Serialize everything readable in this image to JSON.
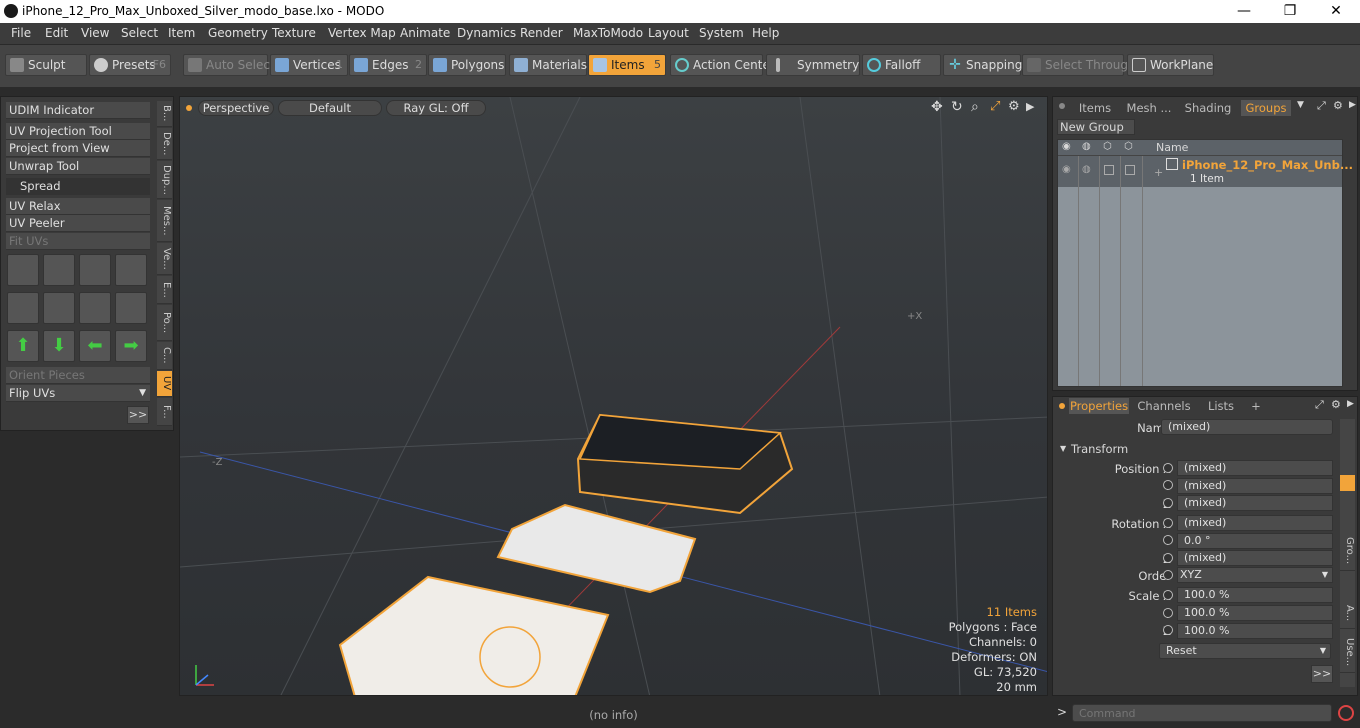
{
  "window": {
    "title": "iPhone_12_Pro_Max_Unboxed_Silver_modo_base.lxo - MODO",
    "minimize": "—",
    "maximize": "❐",
    "close": "✕"
  },
  "menu": [
    "File",
    "Edit",
    "View",
    "Select",
    "Item",
    "Geometry",
    "Texture",
    "Vertex Map",
    "Animate",
    "Dynamics",
    "Render",
    "MaxToModo",
    "Layout",
    "System",
    "Help"
  ],
  "toolbar": {
    "sculpt": "Sculpt",
    "presets": "Presets",
    "presets_key": "F6",
    "auto_select": "Auto Select",
    "vertices": "Vertices",
    "vertices_n": "1",
    "edges": "Edges",
    "edges_n": "2",
    "polygons": "Polygons",
    "materials": "Materials",
    "items": "Items",
    "items_n": "5",
    "action_center": "Action Center",
    "symmetry": "Symmetry",
    "falloff": "Falloff",
    "snapping": "Snapping",
    "select_through": "Select Through",
    "workplane": "WorkPlane"
  },
  "left": {
    "udim": "UDIM Indicator",
    "uv_proj": "UV Projection Tool",
    "proj_view": "Project from View",
    "unwrap": "Unwrap Tool",
    "spread": "Spread",
    "uv_relax": "UV Relax",
    "uv_peeler": "UV Peeler",
    "fit_uvs": "Fit UVs",
    "orient": "Orient Pieces",
    "flip": "Flip UVs",
    "more": ">>",
    "tabs": [
      "B...",
      "De...",
      "Dup...",
      "Mes...",
      "Ve...",
      "E...",
      "Po...",
      "C...",
      "UV",
      "F..."
    ]
  },
  "viewport": {
    "perspective": "Perspective",
    "default": "Default",
    "raygl": "Ray GL: Off",
    "axis_z": "-Z",
    "axis_x": "+X",
    "info": {
      "items": "11 Items",
      "polygons": "Polygons : Face",
      "channels": "Channels: 0",
      "deformers": "Deformers: ON",
      "gl": "GL: 73,520",
      "scale": "20 mm"
    }
  },
  "status": {
    "text": "(no info)"
  },
  "rtop": {
    "tabs": [
      "Items",
      "Mesh ...",
      "Shading",
      "Groups"
    ],
    "new_group": "New Group",
    "col_name": "Name",
    "group_name": "iPhone_12_Pro_Max_Unb...",
    "group_count": "1 Item"
  },
  "rbot": {
    "tabs": [
      "Properties",
      "Channels",
      "Lists",
      "+"
    ],
    "name_label": "Name",
    "name_value": "(mixed)",
    "transform": "Transform",
    "pos_label": "Position X",
    "y": "Y",
    "z": "Z",
    "rot_label": "Rotation X",
    "order_label": "Order",
    "scale_label": "Scale X",
    "pos": [
      "(mixed)",
      "(mixed)",
      "(mixed)"
    ],
    "rot": [
      "(mixed)",
      "0.0 °",
      "(mixed)"
    ],
    "order": "XYZ",
    "scale": [
      "100.0 %",
      "100.0 %",
      "100.0 %"
    ],
    "reset": "Reset",
    "more": ">>",
    "side_tabs": [
      "Gro...",
      "A...",
      "Use..."
    ]
  },
  "command": {
    "prompt": ">",
    "placeholder": "Command"
  },
  "colors": {
    "accent": "#f2a43a",
    "wire": "#f2a43a"
  }
}
